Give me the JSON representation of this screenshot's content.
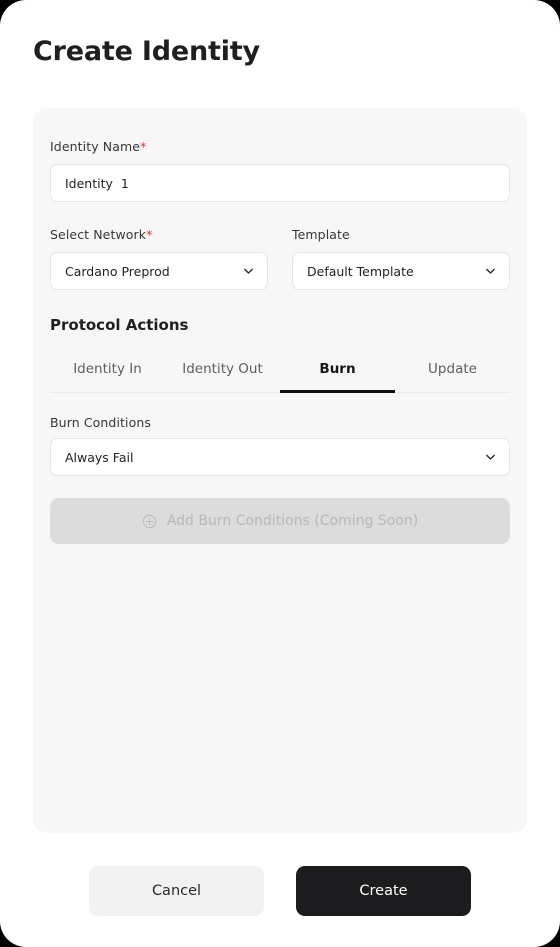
{
  "window": {
    "title": "Create Identity",
    "background_color": "#000000",
    "surface_color": "#ffffff",
    "card_color": "#f7f7f8",
    "accent_color": "#1c1c1e",
    "required_color": "#e03131"
  },
  "form": {
    "identity_name": {
      "label": "Identity Name",
      "required_marker": "*",
      "value": "Identity  1",
      "placeholder": "Identity Name"
    },
    "network": {
      "label": "Select Network",
      "required_marker": "*",
      "value": "Cardano Preprod",
      "chevron_icon": "chevron-down-icon"
    },
    "template": {
      "label": "Template",
      "value": "Default Template",
      "chevron_icon": "chevron-down-icon"
    },
    "protocol_actions": {
      "heading": "Protocol Actions",
      "tabs": [
        {
          "label": "Identity In",
          "active": false
        },
        {
          "label": "Identity Out",
          "active": false
        },
        {
          "label": "Burn",
          "active": true
        },
        {
          "label": "Update",
          "active": false
        }
      ]
    },
    "burn_conditions": {
      "label": "Burn Conditions",
      "value": "Always Fail",
      "chevron_icon": "chevron-down-icon",
      "add_button": {
        "label": "Add Burn Conditions (Coming Soon)",
        "icon": "plus-circle-icon",
        "disabled": true
      }
    }
  },
  "footer": {
    "cancel_label": "Cancel",
    "create_label": "Create"
  }
}
